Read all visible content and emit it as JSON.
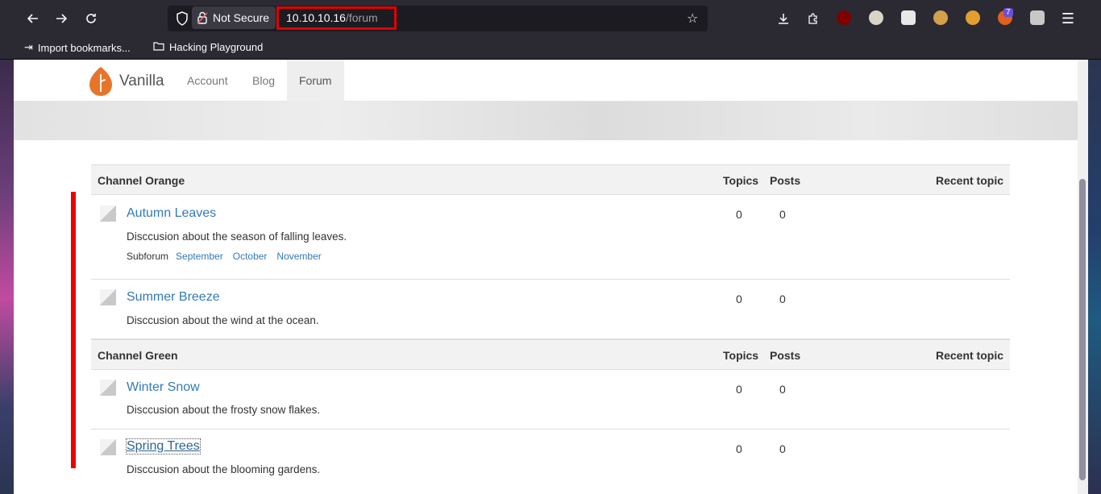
{
  "browser": {
    "security_label": "Not Secure",
    "url_host": "10.10.10.16",
    "url_path": "/forum",
    "extension_badge": "7",
    "bookmarks": [
      {
        "label": "Import bookmarks..."
      },
      {
        "label": "Hacking Playground"
      }
    ]
  },
  "site": {
    "logo_text": "Vanilla",
    "nav": [
      {
        "label": "Account"
      },
      {
        "label": "Blog"
      },
      {
        "label": "Forum"
      }
    ],
    "accent_color": "#e8742a",
    "link_color": "#337ab7"
  },
  "columns": {
    "topics": "Topics",
    "posts": "Posts",
    "recent": "Recent topic"
  },
  "categories": [
    {
      "name": "Channel Orange",
      "forums": [
        {
          "title": "Autumn Leaves",
          "description": "Disccusion about the season of falling leaves.",
          "topics": "0",
          "posts": "0",
          "subforum_label": "Subforum",
          "subforums": [
            "September",
            "October",
            "November"
          ]
        },
        {
          "title": "Summer Breeze",
          "description": "Disccusion about the wind at the ocean.",
          "topics": "0",
          "posts": "0"
        }
      ]
    },
    {
      "name": "Channel Green",
      "forums": [
        {
          "title": "Winter Snow",
          "description": "Disccusion about the frosty snow flakes.",
          "topics": "0",
          "posts": "0"
        },
        {
          "title": "Spring Trees",
          "description": "Disccusion about the blooming gardens.",
          "topics": "0",
          "posts": "0"
        }
      ]
    }
  ]
}
